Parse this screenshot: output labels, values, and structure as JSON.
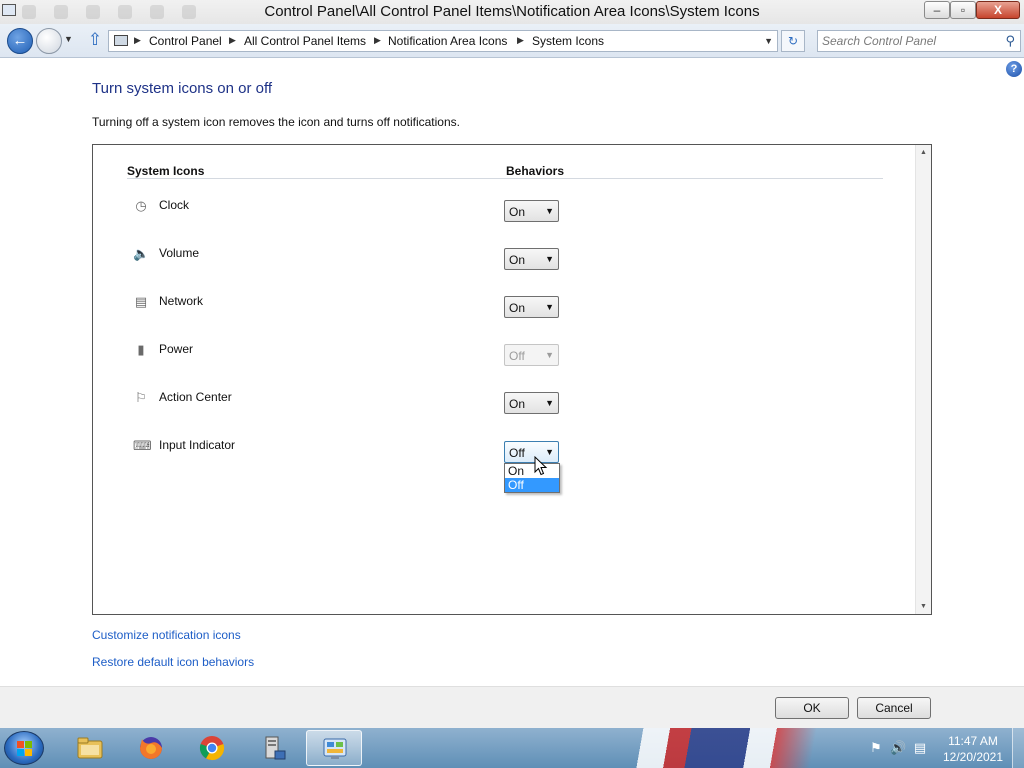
{
  "window": {
    "title": "Control Panel\\All Control Panel Items\\Notification Area Icons\\System Icons",
    "minimize_glyph": "–",
    "maximize_glyph": "▫",
    "close_glyph": "X"
  },
  "address": {
    "breadcrumbs": [
      "Control Panel",
      "All Control Panel Items",
      "Notification Area Icons",
      "System Icons"
    ],
    "search_placeholder": "Search Control Panel"
  },
  "page": {
    "heading": "Turn system icons on or off",
    "description": "Turning off a system icon removes the icon and turns off notifications.",
    "help_glyph": "?"
  },
  "table": {
    "col_icons": "System Icons",
    "col_behaviors": "Behaviors",
    "rows": [
      {
        "icon": "clock-icon",
        "label": "Clock",
        "value": "On",
        "state": "normal"
      },
      {
        "icon": "volume-icon",
        "label": "Volume",
        "value": "On",
        "state": "normal"
      },
      {
        "icon": "network-icon",
        "label": "Network",
        "value": "On",
        "state": "normal"
      },
      {
        "icon": "power-icon",
        "label": "Power",
        "value": "Off",
        "state": "disabled"
      },
      {
        "icon": "action-center-flag-icon",
        "label": "Action Center",
        "value": "On",
        "state": "normal"
      },
      {
        "icon": "keyboard-icon",
        "label": "Input Indicator",
        "value": "Off",
        "state": "open"
      }
    ],
    "dropdown_options": [
      "On",
      "Off"
    ],
    "dropdown_highlighted": "Off"
  },
  "links": {
    "customize": "Customize notification icons",
    "restore": "Restore default icon behaviors"
  },
  "buttons": {
    "ok": "OK",
    "cancel": "Cancel"
  },
  "taskbar": {
    "apps": [
      "file-explorer",
      "firefox",
      "chrome",
      "server-manager",
      "control-panel"
    ],
    "active_app": "control-panel",
    "time": "11:47 AM",
    "date": "12/20/2021"
  },
  "colors": {
    "heading": "#1e3287",
    "link": "#1e5ec7",
    "selection": "#3399ff"
  }
}
